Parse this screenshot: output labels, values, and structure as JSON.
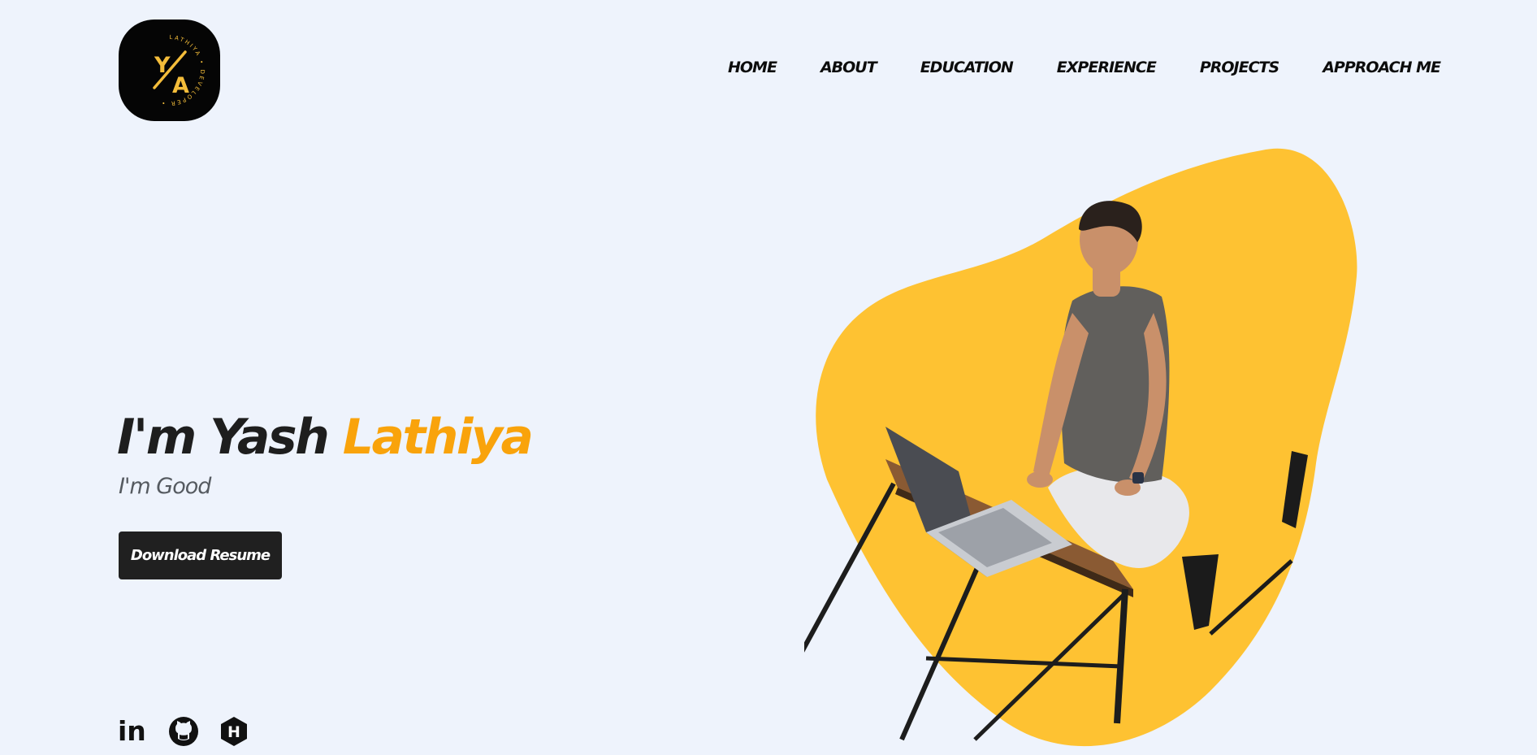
{
  "logo": {
    "initials_top": "Y",
    "initials_bottom": "A",
    "ring_text": "LATHIYA • DEVELOPER •",
    "accent": "#f4bd3a"
  },
  "nav": {
    "items": [
      "HOME",
      "ABOUT",
      "EDUCATION",
      "EXPERIENCE",
      "PROJECTS",
      "APPROACH ME"
    ]
  },
  "hero": {
    "title_prefix": "I'm Yash ",
    "title_accent": "Lathiya",
    "tagline": "I'm Good",
    "download_label": "Download Resume"
  },
  "social": {
    "linkedin_label": "in",
    "hashnode_letter": "H",
    "icons": [
      "linkedin-icon",
      "github-icon",
      "hashnode-icon"
    ]
  },
  "colors": {
    "background": "#eef3fc",
    "accent": "#f9a30b",
    "blob": "#fec232",
    "dark": "#202020"
  }
}
